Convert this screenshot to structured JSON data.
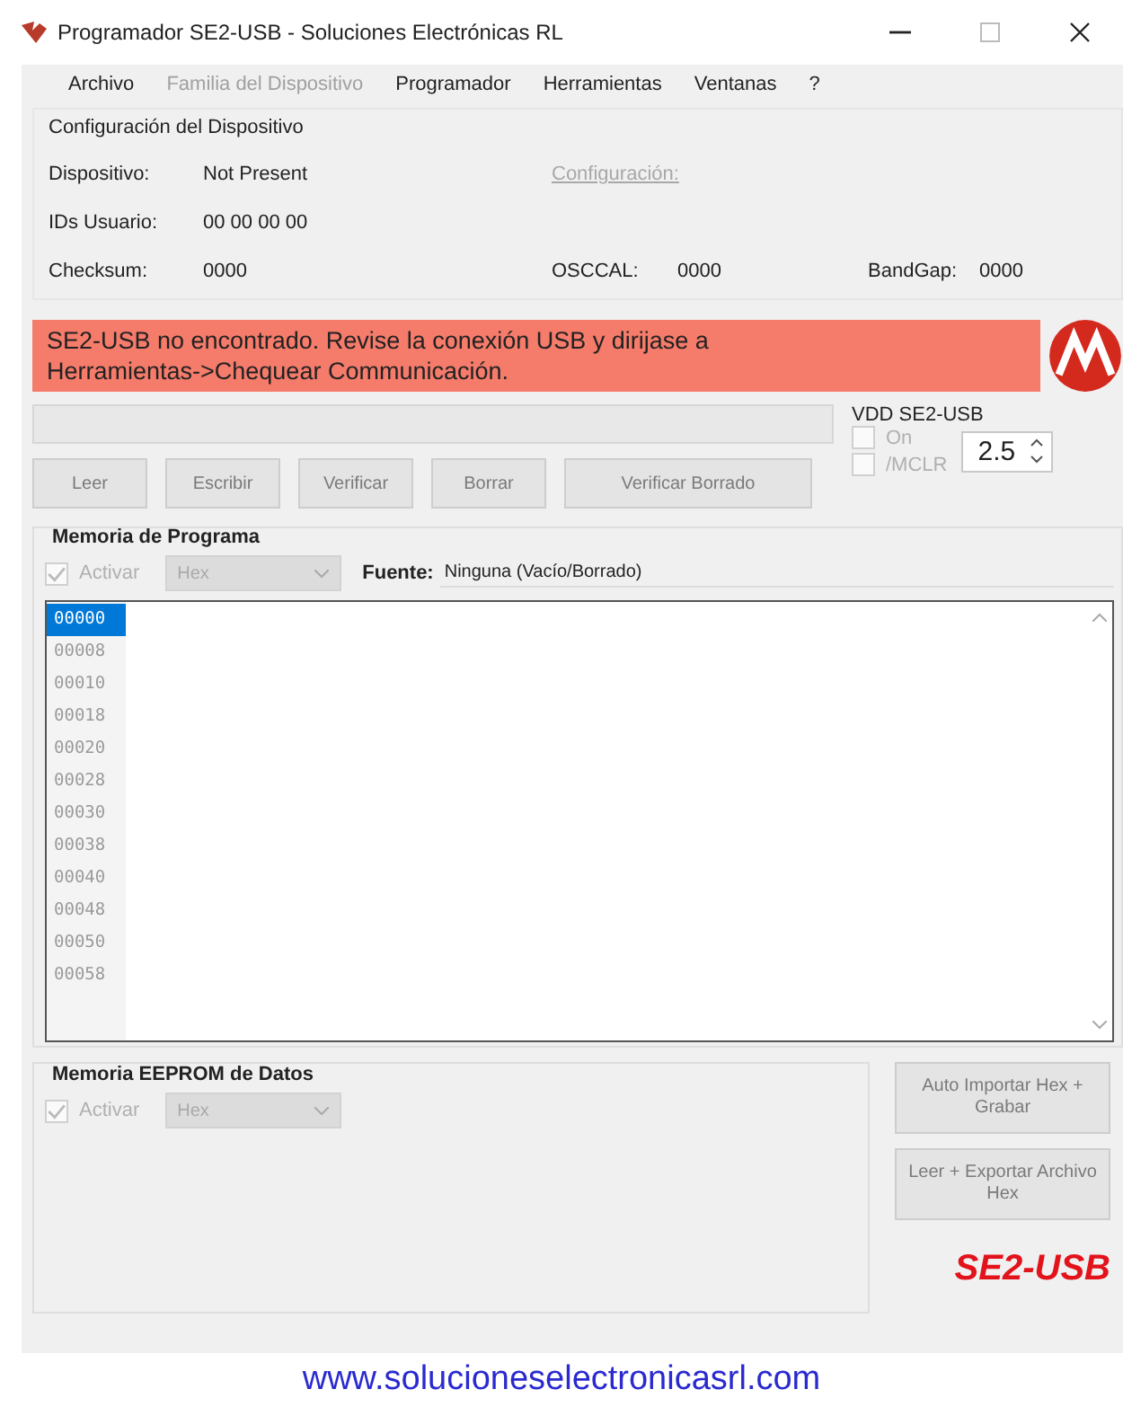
{
  "window": {
    "title": "Programador SE2-USB  -  Soluciones Electrónicas RL"
  },
  "menu": [
    {
      "label": "Archivo",
      "disabled": false
    },
    {
      "label": "Familia del Dispositivo",
      "disabled": true
    },
    {
      "label": "Programador",
      "disabled": false
    },
    {
      "label": "Herramientas",
      "disabled": false
    },
    {
      "label": "Ventanas",
      "disabled": false
    },
    {
      "label": "?",
      "disabled": false
    }
  ],
  "device_config": {
    "title": "Configuración del Dispositivo",
    "device_label": "Dispositivo:",
    "device_value": "Not Present",
    "config_link": "Configuración:",
    "user_ids_label": "IDs Usuario:",
    "user_ids_value": "00 00 00 00",
    "checksum_label": "Checksum:",
    "checksum_value": "0000",
    "osccal_label": "OSCCAL:",
    "osccal_value": "0000",
    "bandgap_label": "BandGap:",
    "bandgap_value": "0000"
  },
  "status_message": [
    "SE2-USB no encontrado.  Revise la conexión USB y dirijase a",
    "Herramientas->Chequear Communicación."
  ],
  "actions": [
    {
      "label": "Leer",
      "disabled": true
    },
    {
      "label": "Escribir",
      "disabled": true
    },
    {
      "label": "Verificar",
      "disabled": true
    },
    {
      "label": "Borrar",
      "disabled": true
    },
    {
      "label": "Verificar Borrado",
      "disabled": true
    }
  ],
  "vdd": {
    "title": "VDD SE2-USB",
    "on_label": "On",
    "on_checked": false,
    "mclr_label": "/MCLR",
    "mclr_checked": false,
    "voltage": "2.5"
  },
  "program_memory": {
    "title": "Memoria de Programa",
    "enable_label": "Activar",
    "enable_checked": true,
    "format": "Hex",
    "source_label": "Fuente:",
    "source_value": "Ninguna (Vacío/Borrado)",
    "rows": [
      {
        "address": "00000",
        "selected": true
      },
      {
        "address": "00008",
        "selected": false
      },
      {
        "address": "00010",
        "selected": false
      },
      {
        "address": "00018",
        "selected": false
      },
      {
        "address": "00020",
        "selected": false
      },
      {
        "address": "00028",
        "selected": false
      },
      {
        "address": "00030",
        "selected": false
      },
      {
        "address": "00038",
        "selected": false
      },
      {
        "address": "00040",
        "selected": false
      },
      {
        "address": "00048",
        "selected": false
      },
      {
        "address": "00050",
        "selected": false
      },
      {
        "address": "00058",
        "selected": false
      }
    ]
  },
  "eeprom": {
    "title": "Memoria EEPROM de Datos",
    "enable_label": "Activar",
    "enable_checked": true,
    "format": "Hex"
  },
  "side_buttons": [
    {
      "label": "Auto Importar Hex + Grabar",
      "disabled": true
    },
    {
      "label": "Leer + Exportar Archivo Hex",
      "disabled": true
    }
  ],
  "brand": "SE2-USB",
  "website": "www.solucioneselectronicasrl.com"
}
